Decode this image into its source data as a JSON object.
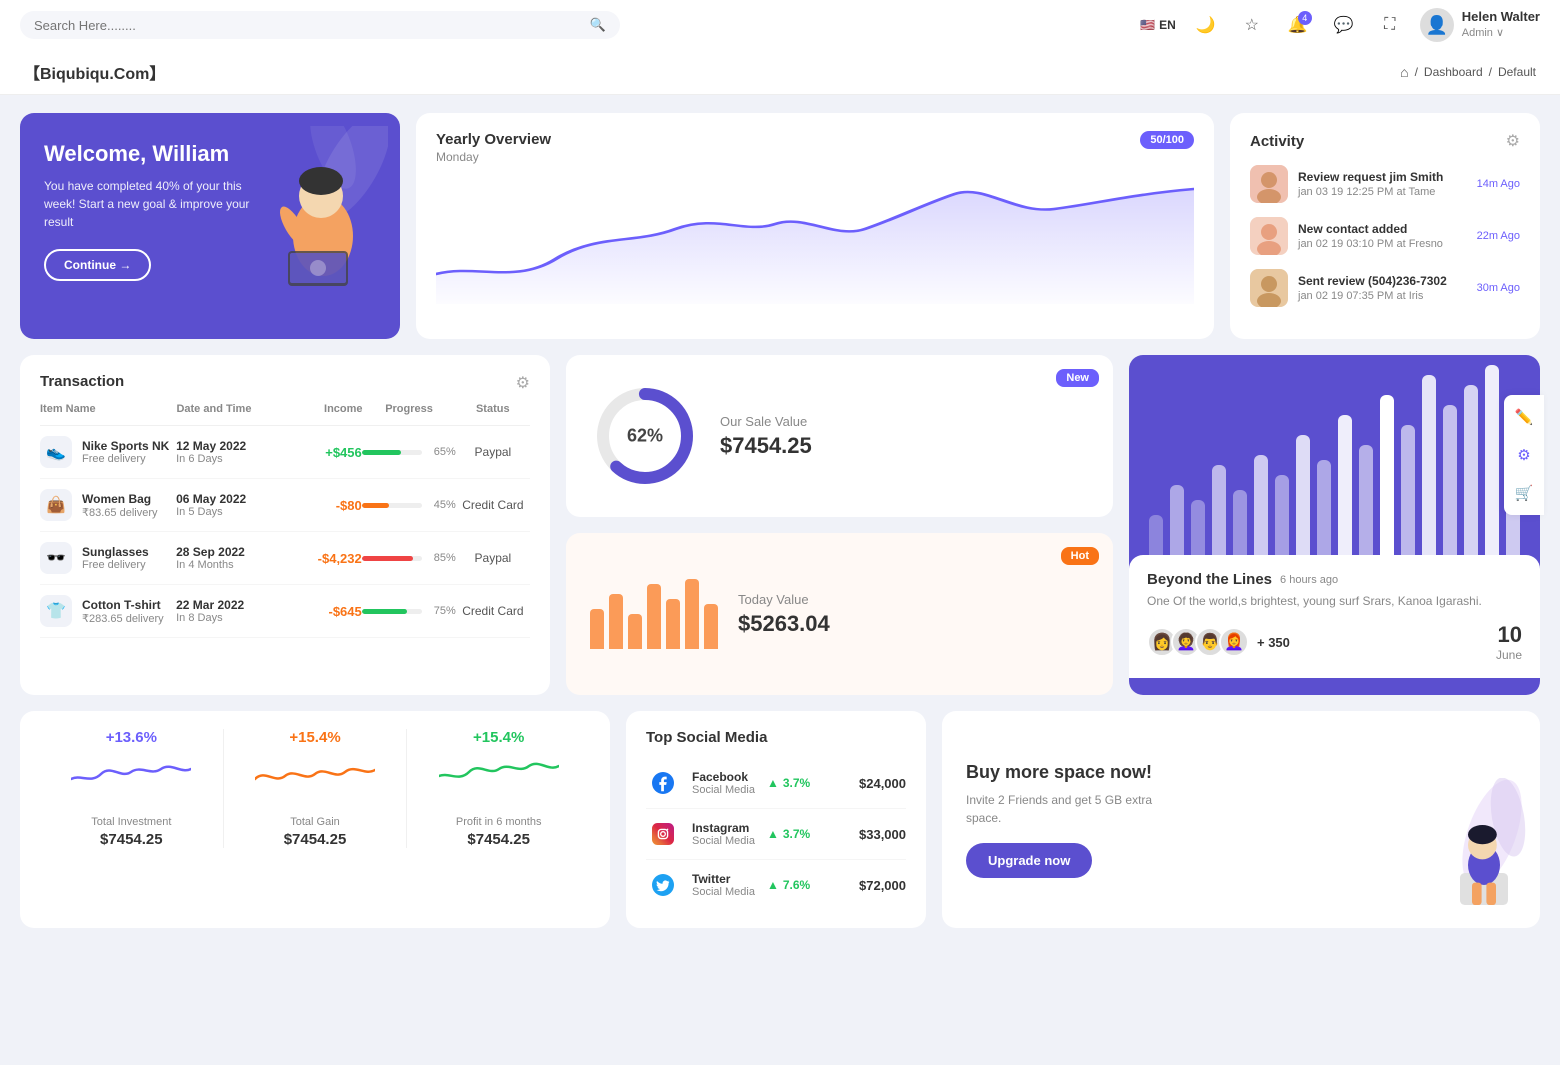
{
  "topnav": {
    "search_placeholder": "Search Here........",
    "lang": "EN",
    "notification_count": "4",
    "user_name": "Helen Walter",
    "user_role": "Admin ∨"
  },
  "breadcrumb": {
    "brand": "【Biqubiqu.Com】",
    "home": "⌂",
    "separator": "/",
    "dashboard": "Dashboard",
    "current": "Default"
  },
  "welcome": {
    "title": "Welcome, William",
    "desc": "You have completed 40% of your this week! Start a new goal & improve your result",
    "button": "Continue →"
  },
  "yearly": {
    "title": "Yearly Overview",
    "subtitle": "Monday",
    "badge": "50/100"
  },
  "activity": {
    "title": "Activity",
    "items": [
      {
        "title": "Review request jim Smith",
        "sub": "jan 03 19 12:25 PM at Tame",
        "time": "14m Ago"
      },
      {
        "title": "New contact added",
        "sub": "jan 02 19 03:10 PM at Fresno",
        "time": "22m Ago"
      },
      {
        "title": "Sent review (504)236-7302",
        "sub": "jan 02 19 07:35 PM at Iris",
        "time": "30m Ago"
      }
    ]
  },
  "transaction": {
    "title": "Transaction",
    "headers": {
      "name": "Item Name",
      "date": "Date and Time",
      "income": "Income",
      "progress": "Progress",
      "status": "Status"
    },
    "rows": [
      {
        "icon": "👟",
        "name": "Nike Sports NK",
        "sub": "Free delivery",
        "date": "12 May 2022",
        "date_sub": "In 6 Days",
        "income": "+$456",
        "income_type": "pos",
        "progress": 65,
        "progress_color": "#22c55e",
        "status": "Paypal"
      },
      {
        "icon": "👜",
        "name": "Women Bag",
        "sub": "₹83.65 delivery",
        "date": "06 May 2022",
        "date_sub": "In 5 Days",
        "income": "-$80",
        "income_type": "neg",
        "progress": 45,
        "progress_color": "#f97316",
        "status": "Credit Card"
      },
      {
        "icon": "🕶️",
        "name": "Sunglasses",
        "sub": "Free delivery",
        "date": "28 Sep 2022",
        "date_sub": "In 4 Months",
        "income": "-$4,232",
        "income_type": "neg",
        "progress": 85,
        "progress_color": "#ef4444",
        "status": "Paypal"
      },
      {
        "icon": "👕",
        "name": "Cotton T-shirt",
        "sub": "₹283.65 delivery",
        "date": "22 Mar 2022",
        "date_sub": "In 8 Days",
        "income": "-$645",
        "income_type": "neg",
        "progress": 75,
        "progress_color": "#22c55e",
        "status": "Credit Card"
      }
    ]
  },
  "sale": {
    "badge": "New",
    "percent": "62%",
    "label": "Our Sale Value",
    "value": "$7454.25"
  },
  "today": {
    "badge": "Hot",
    "label": "Today Value",
    "value": "$5263.04",
    "bars": [
      40,
      55,
      35,
      65,
      50,
      70,
      45
    ]
  },
  "beyond": {
    "title": "Beyond the Lines",
    "time": "6 hours ago",
    "desc": "One Of the world,s brightest, young surf Srars, Kanoa Igarashi.",
    "plus_count": "+ 350",
    "date_num": "10",
    "date_month": "June"
  },
  "stats": [
    {
      "pct": "+13.6%",
      "color": "purple",
      "label": "Total Investment",
      "value": "$7454.25"
    },
    {
      "pct": "+15.4%",
      "color": "orange",
      "label": "Total Gain",
      "value": "$7454.25"
    },
    {
      "pct": "+15.4%",
      "color": "green",
      "label": "Profit in 6 months",
      "value": "$7454.25"
    }
  ],
  "social": {
    "title": "Top Social Media",
    "items": [
      {
        "name": "Facebook",
        "sub": "Social Media",
        "icon": "f",
        "color": "#1877f2",
        "growth": "3.7%",
        "amount": "$24,000"
      },
      {
        "name": "Instagram",
        "sub": "Social Media",
        "icon": "ig",
        "color": "#e1306c",
        "growth": "3.7%",
        "amount": "$33,000"
      },
      {
        "name": "Twitter",
        "sub": "Social Media",
        "icon": "tw",
        "color": "#1da1f2",
        "growth": "7.6%",
        "amount": "$72,000"
      }
    ]
  },
  "upgrade": {
    "title": "Buy more space now!",
    "desc": "Invite 2 Friends and get 5 GB extra space.",
    "button": "Upgrade now"
  }
}
